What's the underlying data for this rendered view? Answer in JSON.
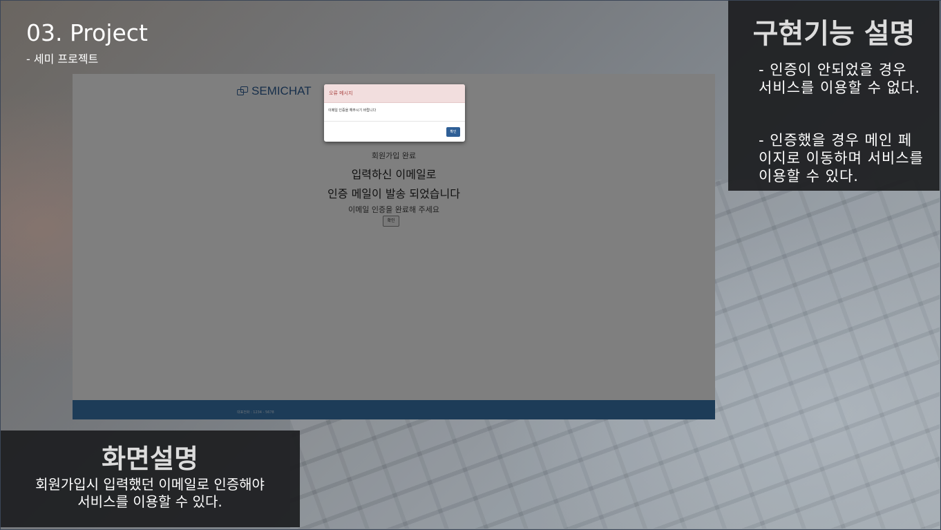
{
  "slide": {
    "title": "03. Project",
    "subtitle": "- 세미 프로젝트"
  },
  "info_panel": {
    "title": "구현기능 설명",
    "point1": "- 인증이 안되었을 경우 서비스를 이용할 수 없다.",
    "point2": "- 인증했을 경우 메인 페이지로 이동하며 서비스를 이용할 수 있다."
  },
  "desc_panel": {
    "title": "화면설명",
    "line1": "회원가입시 입력했던 이메일로 인증해야",
    "line2": "서비스를 이용할 수 있다."
  },
  "app": {
    "logo_text": "SEMICHAT",
    "signup_done": "회원가입 완료",
    "heading1": "입력하신 이메일로",
    "heading2": "인증 메일이 발송 되었습니다",
    "instruction": "이메일 인증을 완료해 주세요",
    "confirm_label": "확인",
    "footer_text": "대표전화 : 1234 - 5678",
    "brand_color": "#2f5f96",
    "footer_color": "#3a78b0"
  },
  "modal": {
    "title": "오류 메시지",
    "message": "이메일 인증을 해주시기 바랍니다",
    "ok_label": "확인",
    "header_color": "#f2dede"
  }
}
